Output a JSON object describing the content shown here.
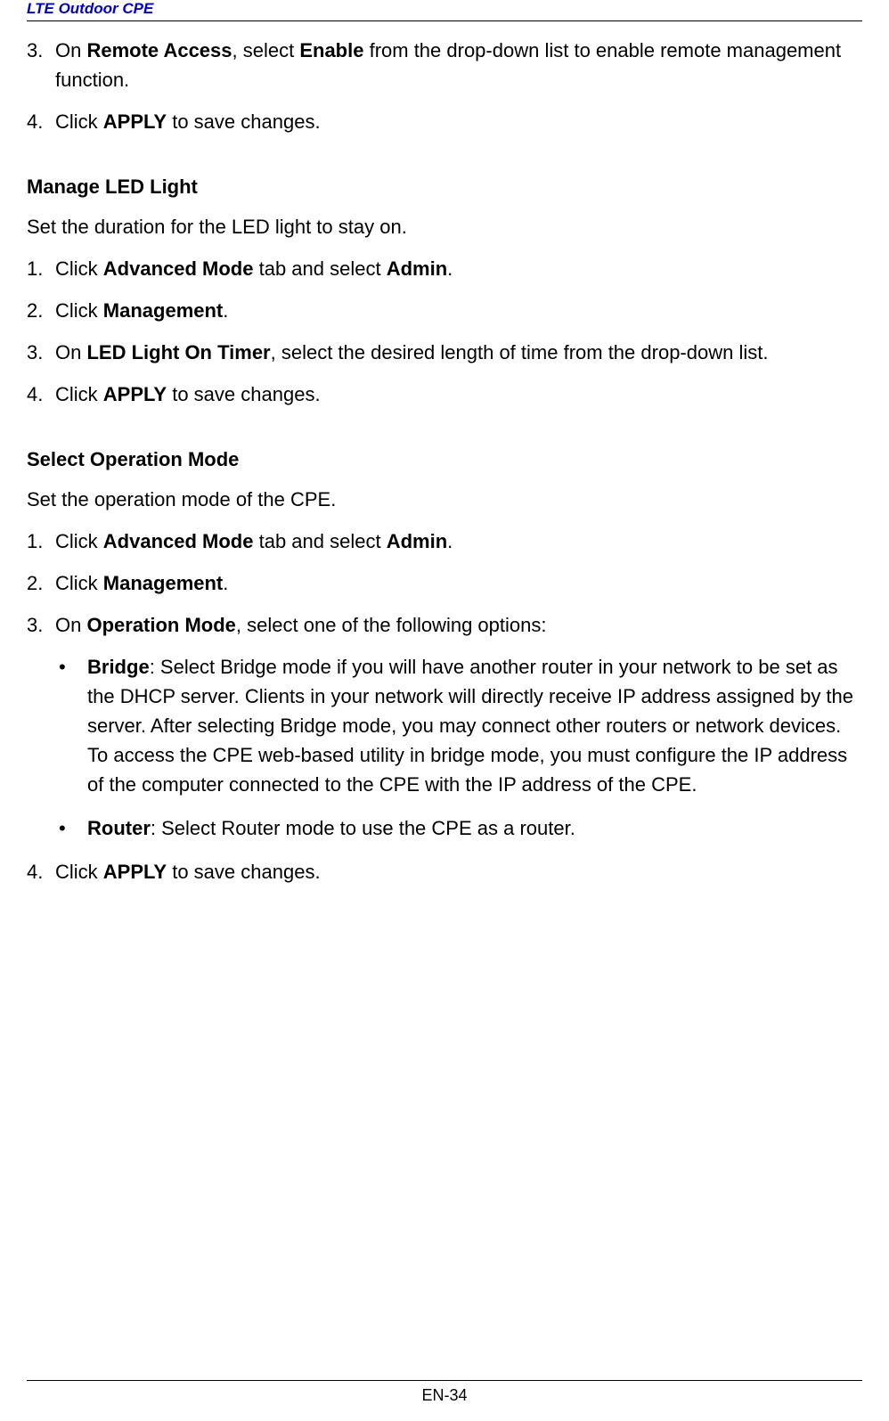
{
  "header": "LTE Outdoor CPE",
  "section1": {
    "item3_prefix": "On ",
    "item3_bold1": "Remote Access",
    "item3_mid": ", select ",
    "item3_bold2": "Enable",
    "item3_suffix": " from the drop-down list to enable remote management function.",
    "item4_prefix": "Click ",
    "item4_bold": "APPLY",
    "item4_suffix": " to save changes."
  },
  "section2": {
    "heading": "Manage LED Light",
    "desc": "Set the duration for the LED light to stay on.",
    "item1_prefix": "Click ",
    "item1_bold1": "Advanced Mode",
    "item1_mid": " tab and select ",
    "item1_bold2": "Admin",
    "item1_suffix": ".",
    "item2_prefix": "Click ",
    "item2_bold": "Management",
    "item2_suffix": ".",
    "item3_prefix": "On ",
    "item3_bold": "LED Light On Timer",
    "item3_suffix": ", select the desired length of time from the drop-down list.",
    "item4_prefix": "Click ",
    "item4_bold": "APPLY",
    "item4_suffix": " to save changes."
  },
  "section3": {
    "heading": "Select Operation Mode",
    "desc": "Set the operation mode of the CPE.",
    "item1_prefix": "Click ",
    "item1_bold1": "Advanced Mode",
    "item1_mid": " tab and select ",
    "item1_bold2": "Admin",
    "item1_suffix": ".",
    "item2_prefix": "Click ",
    "item2_bold": "Management",
    "item2_suffix": ".",
    "item3_prefix": "On ",
    "item3_bold": "Operation Mode",
    "item3_suffix": ", select one of the following options:",
    "bullet1_bold": "Bridge",
    "bullet1_text": ": Select Bridge mode if you will have another router in your network to be set as the DHCP server. Clients in your network will directly receive IP address assigned by the server. After selecting Bridge mode, you may connect other routers or network devices. To access the CPE web-based utility in bridge mode, you must configure the IP address of the computer connected to the CPE with the IP address of the CPE.",
    "bullet2_bold": "Router",
    "bullet2_text": ": Select Router mode to use the CPE as a router.",
    "item4_prefix": "Click ",
    "item4_bold": "APPLY",
    "item4_suffix": " to save changes."
  },
  "numbers": {
    "n3": "3.",
    "n4": "4.",
    "n1": "1.",
    "n2": "2."
  },
  "bullet": "•",
  "footer": "EN-34"
}
